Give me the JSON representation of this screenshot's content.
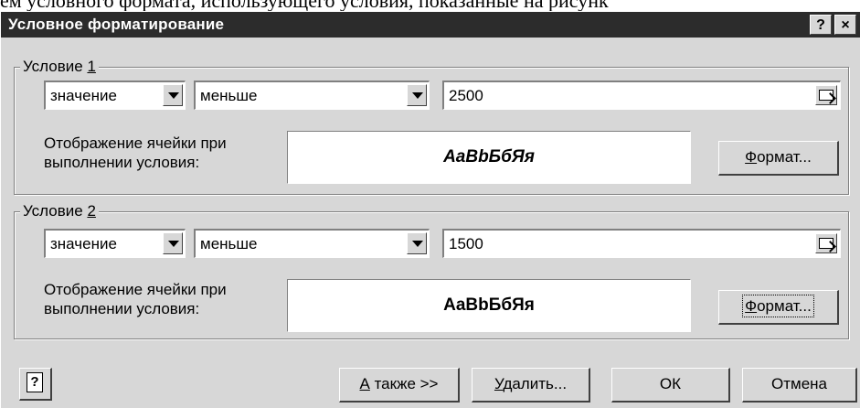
{
  "page_text": "ем условного формата, использующего условия, показанные на рисунк",
  "dialog": {
    "title": "Условное форматирование",
    "help_glyph": "?",
    "close_glyph": "×"
  },
  "conditions": [
    {
      "legend_prefix": "Условие ",
      "legend_number": "1",
      "value_type": "значение",
      "operator": "меньше",
      "value": "2500",
      "preview_label_line1": "Отображение ячейки при",
      "preview_label_line2": "выполнении условия:",
      "preview_sample": "AaBbБбЯя",
      "format_button": {
        "mnemonic": "Ф",
        "rest": "ормат..."
      }
    },
    {
      "legend_prefix": "Условие ",
      "legend_number": "2",
      "value_type": "значение",
      "operator": "меньше",
      "value": "1500",
      "preview_label_line1": "Отображение ячейки при",
      "preview_label_line2": "выполнении условия:",
      "preview_sample": "AaBbБбЯя",
      "format_button": {
        "mnemonic": "Ф",
        "rest": "ормат..."
      }
    }
  ],
  "footer": {
    "also_button": {
      "mnemonic": "А",
      "rest": " также >>"
    },
    "delete_button": {
      "mnemonic": "У",
      "rest": "далить..."
    },
    "ok_button": "ОК",
    "cancel_button": "Отмена"
  },
  "icons": {
    "help": "help-icon",
    "reference": "range-select-icon",
    "dropdown": "chevron-down-icon"
  }
}
